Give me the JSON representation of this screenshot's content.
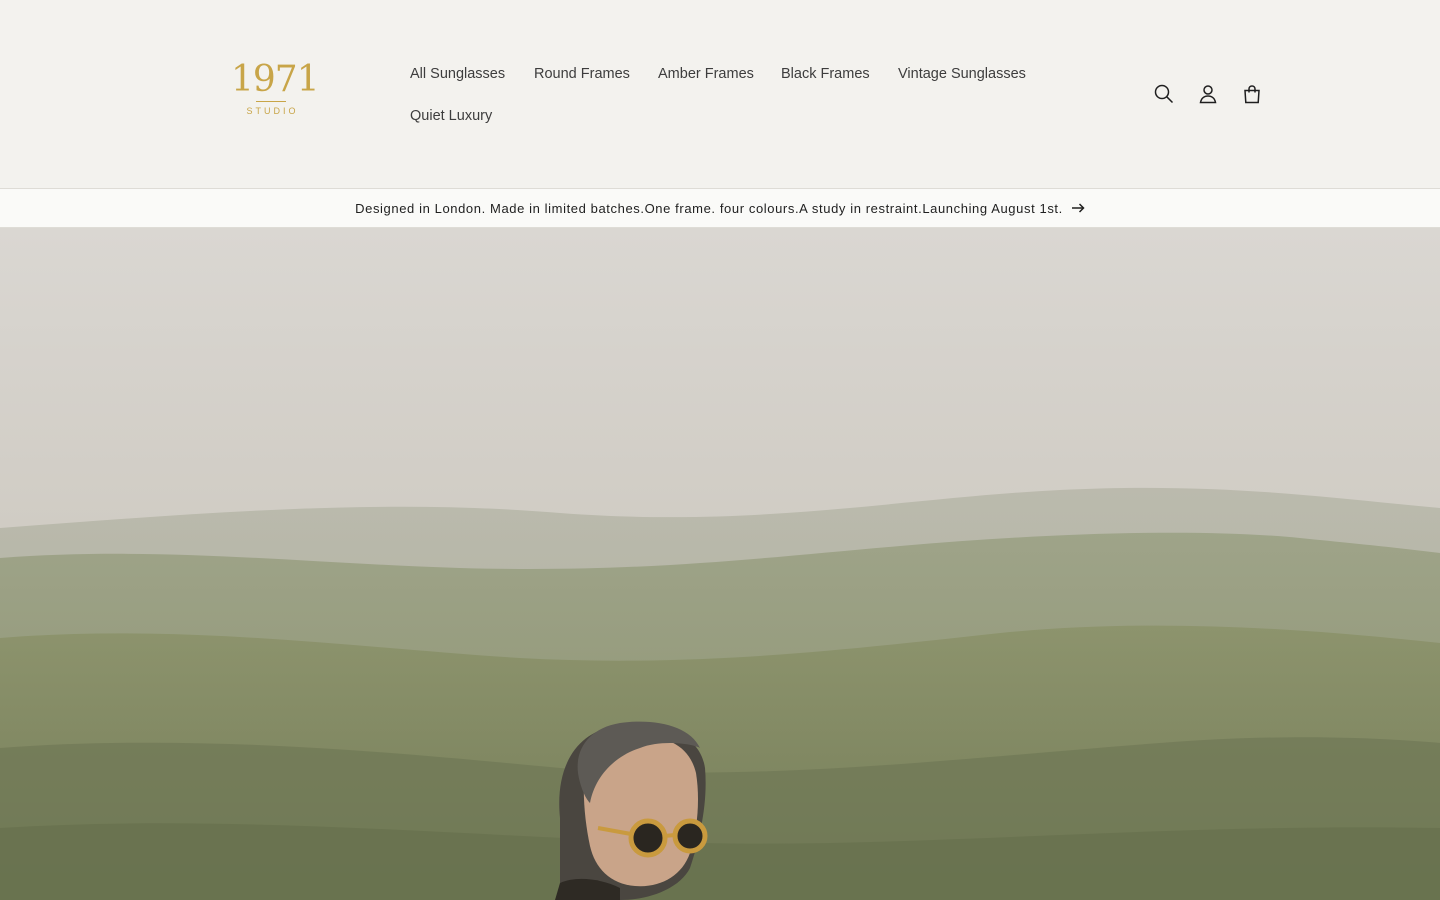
{
  "brand": {
    "logo_number": "1971",
    "logo_subtitle": "STUDIO",
    "color": "#c8a548"
  },
  "nav": {
    "items": [
      {
        "label": "All Sunglasses"
      },
      {
        "label": "Round Frames"
      },
      {
        "label": "Amber Frames"
      },
      {
        "label": "Black Frames"
      },
      {
        "label": "Vintage Sunglasses"
      },
      {
        "label": "Quiet Luxury"
      }
    ]
  },
  "header_icons": [
    {
      "name": "search-icon"
    },
    {
      "name": "account-icon"
    },
    {
      "name": "cart-icon"
    }
  ],
  "announcement": {
    "text": "Designed in London. Made in limited batches.One frame. four colours.A study in restraint.Launching August 1st.",
    "icon": "arrow-right-icon"
  },
  "hero": {
    "image_description_alt": ""
  },
  "colors": {
    "background": "#f3f2ee",
    "announcement_bg": "#fafaf8",
    "text": "#1f1f1f"
  }
}
